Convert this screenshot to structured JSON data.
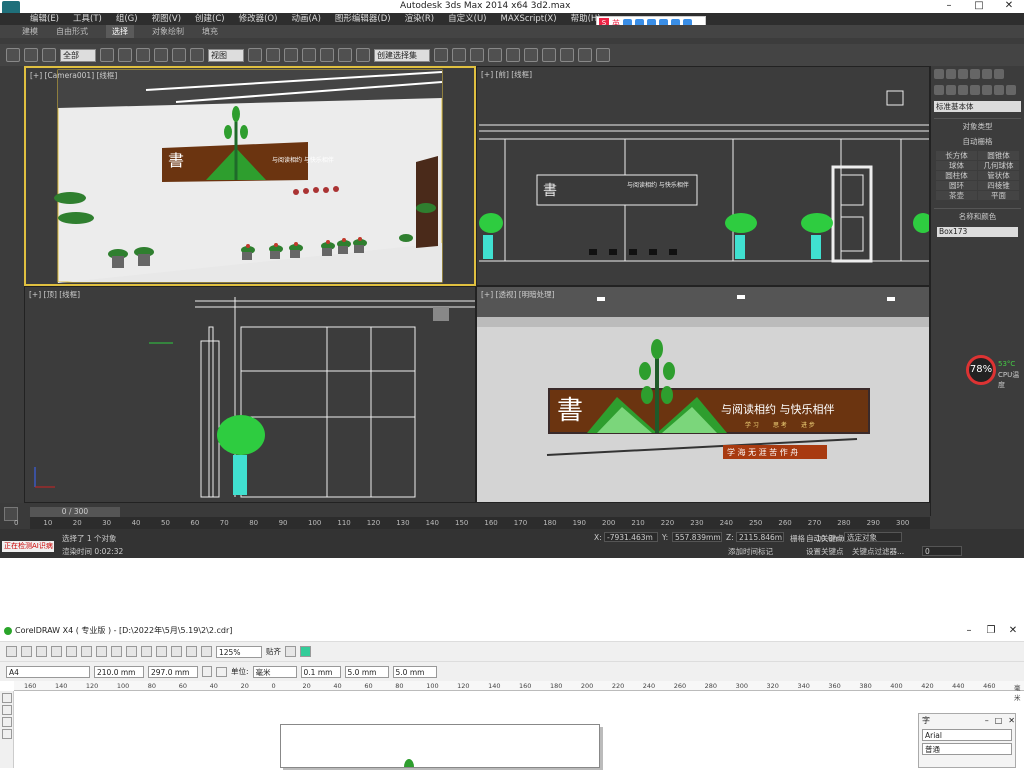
{
  "max": {
    "title": "Autodesk 3ds Max  2014 x64      3d2.max",
    "menu": [
      "编辑(E)",
      "工具(T)",
      "组(G)",
      "视图(V)",
      "创建(C)",
      "修改器(O)",
      "动画(A)",
      "图形编辑器(D)",
      "渲染(R)",
      "自定义(U)",
      "MAXScript(X)",
      "帮助(H)"
    ],
    "ribbon_tabs": [
      "建模",
      "自由形式",
      "选择",
      "对象绘制",
      "填充"
    ],
    "ribbon_active": "选择",
    "toolbar_filter": "全部",
    "toolbar_view": "视图",
    "toolbar_selset": "创建选择集",
    "viewports": {
      "camera": "[+] [Camera001] [线框]",
      "front": "[+] [前] [线框]",
      "top": "[+] [顶] [线框]",
      "persp": "[+] [透视] [明暗处理]"
    },
    "sign": {
      "logo_char": "書",
      "slogan": "与阅读相约  与快乐相伴",
      "sub_items": [
        "学 习",
        "思 考",
        "进 步"
      ],
      "bottom_line": "学 海 无 涯 苦 作 舟"
    },
    "cmd_panel": {
      "category": "标准基本体",
      "section_object_type": "对象类型",
      "auto_grid": "自动栅格",
      "objects": [
        "长方体",
        "圆锥体",
        "球体",
        "几何球体",
        "圆柱体",
        "管状体",
        "圆环",
        "四棱锥",
        "茶壶",
        "平面"
      ],
      "section_name_color": "名称和颜色",
      "name_value": "Box173"
    },
    "timeline": {
      "slider": "0 / 300",
      "ticks": [
        "0",
        "10",
        "20",
        "30",
        "40",
        "50",
        "60",
        "70",
        "80",
        "90",
        "100",
        "110",
        "120",
        "130",
        "140",
        "150",
        "160",
        "170",
        "180",
        "190",
        "200",
        "210",
        "220",
        "230",
        "240",
        "250",
        "260",
        "270",
        "280",
        "290",
        "300"
      ]
    },
    "status": {
      "ai_label": "正在检测AI识病",
      "selection": "选择了 1 个对象",
      "render_time": "渲染时间 0:02:32",
      "x_label": "X:",
      "x_value": "-7931.463m",
      "y_label": "Y:",
      "y_value": "557.839mm",
      "z_label": "Z:",
      "z_value": "2115.846m",
      "grid": "栅格 = 10.0mm",
      "auto_key": "自动关键点",
      "set_key": "设置关键点",
      "key_mode": "选定对象",
      "key_filter": "关键点过滤器...",
      "add_time_tag": "添加时间标记",
      "frame": "0"
    },
    "cpu": {
      "percent": "78%",
      "temp": "53°C",
      "label": "CPU温度"
    }
  },
  "cdr": {
    "title": "CorelDRAW X4 ( 专业版 ) - [D:\\2022年\\5月\\5.19\\2\\2.cdr]",
    "zoom": "125%",
    "snap": "贴齐",
    "page_size": "A4",
    "width": "210.0 mm",
    "height": "297.0 mm",
    "unit_label": "单位:",
    "unit": "毫米",
    "nudge": "0.1 mm",
    "dup_x": "5.0 mm",
    "dup_y": "5.0 mm",
    "ruler_ticks": [
      "160",
      "140",
      "120",
      "100",
      "80",
      "60",
      "40",
      "20",
      "0",
      "20",
      "40",
      "60",
      "80",
      "100",
      "120",
      "140",
      "160",
      "180",
      "200",
      "220",
      "240",
      "260",
      "280",
      "300",
      "320",
      "340",
      "360",
      "380",
      "400",
      "420",
      "440",
      "460",
      "毫米"
    ],
    "font_panel_title": "字",
    "font": "Arial",
    "font_style": "普通"
  },
  "colors": {
    "sign_brown": "#6b3410",
    "leaf_green": "#2e9e2e",
    "viewport_bg": "#3c3c3c",
    "wall_grey": "#d4d4d4"
  }
}
